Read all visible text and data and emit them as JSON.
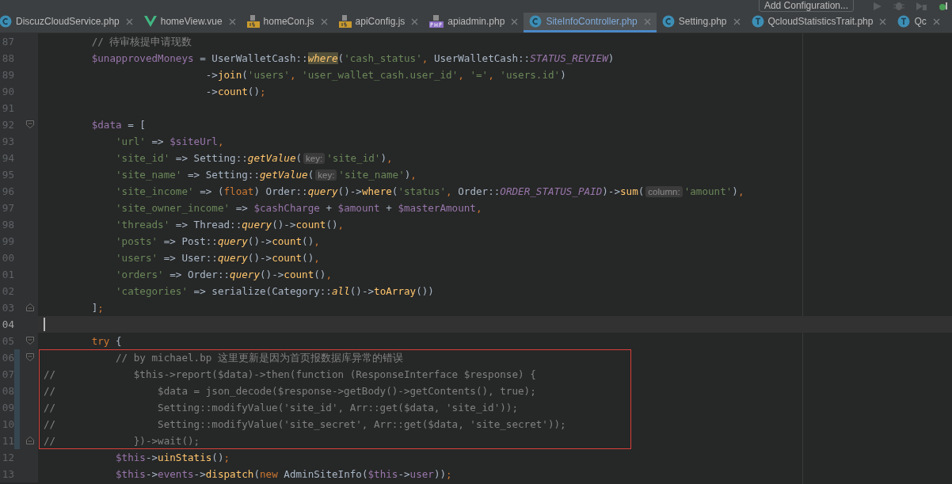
{
  "toolbar": {
    "run_configuration": "Add Configuration..."
  },
  "tabs": [
    {
      "label": "DiscuzCloudService.php",
      "kind": "class",
      "selected": false
    },
    {
      "label": "homeView.vue",
      "kind": "vue",
      "selected": false
    },
    {
      "label": "homeCon.js",
      "kind": "js",
      "selected": false
    },
    {
      "label": "apiConfig.js",
      "kind": "js",
      "selected": false
    },
    {
      "label": "apiadmin.php",
      "kind": "php",
      "selected": false
    },
    {
      "label": "SiteInfoController.php",
      "kind": "class",
      "selected": true
    },
    {
      "label": "Setting.php",
      "kind": "class",
      "selected": false
    },
    {
      "label": "QcloudStatisticsTrait.php",
      "kind": "trait",
      "selected": false
    },
    {
      "label": "Qc",
      "kind": "trait",
      "selected": false
    }
  ],
  "editor": {
    "lines": [
      {
        "number": "87",
        "current": false,
        "changed": false,
        "framed": false,
        "tokens": [
          {
            "kind": "comment",
            "text": "        // 待审核提申请现数"
          }
        ]
      },
      {
        "number": "88",
        "current": false,
        "changed": false,
        "framed": false,
        "tokens": [
          {
            "kind": "var",
            "text": "        $unapprovedMoneys"
          },
          {
            "kind": "plain",
            "text": " = UserWalletCash::"
          },
          {
            "kind": "match",
            "text": "where"
          },
          {
            "kind": "plain",
            "text": "("
          },
          {
            "kind": "str",
            "text": "'cash_status'"
          },
          {
            "kind": "punct",
            "text": ", "
          },
          {
            "kind": "plain",
            "text": "UserWalletCash::"
          },
          {
            "kind": "const",
            "text": "STATUS_REVIEW"
          },
          {
            "kind": "plain",
            "text": ")"
          }
        ]
      },
      {
        "number": "89",
        "current": false,
        "changed": false,
        "framed": false,
        "tokens": [
          {
            "kind": "plain",
            "text": "                           ->"
          },
          {
            "kind": "fn",
            "text": "join"
          },
          {
            "kind": "plain",
            "text": "("
          },
          {
            "kind": "str",
            "text": "'users'"
          },
          {
            "kind": "punct",
            "text": ", "
          },
          {
            "kind": "str",
            "text": "'user_wallet_cash.user_id'"
          },
          {
            "kind": "punct",
            "text": ", "
          },
          {
            "kind": "str",
            "text": "'='"
          },
          {
            "kind": "punct",
            "text": ", "
          },
          {
            "kind": "str",
            "text": "'users.id'"
          },
          {
            "kind": "plain",
            "text": ")"
          }
        ]
      },
      {
        "number": "90",
        "current": false,
        "changed": false,
        "framed": false,
        "tokens": [
          {
            "kind": "plain",
            "text": "                           ->"
          },
          {
            "kind": "fn",
            "text": "count"
          },
          {
            "kind": "plain",
            "text": "()"
          },
          {
            "kind": "punct",
            "text": ";"
          }
        ]
      },
      {
        "number": "91",
        "current": false,
        "changed": false,
        "framed": false
      },
      {
        "number": "92",
        "current": false,
        "changed": false,
        "framed": false,
        "kind": "opener",
        "tokens": [
          {
            "kind": "var",
            "text": "        $data"
          },
          {
            "kind": "plain",
            "text": " = ["
          }
        ]
      },
      {
        "number": "93",
        "current": false,
        "changed": false,
        "framed": false,
        "tokens": [
          {
            "kind": "str",
            "text": "            'url'"
          },
          {
            "kind": "plain",
            "text": " => "
          },
          {
            "kind": "var",
            "text": "$siteUrl"
          },
          {
            "kind": "punct",
            "text": ","
          }
        ]
      },
      {
        "number": "94",
        "current": false,
        "changed": false,
        "framed": false,
        "tokens": [
          {
            "kind": "str",
            "text": "            'site_id'"
          },
          {
            "kind": "plain",
            "text": " => Setting::"
          },
          {
            "kind": "static",
            "text": "getValue"
          },
          {
            "kind": "plain",
            "text": "("
          },
          {
            "kind": "hint",
            "text": "key:"
          },
          {
            "kind": "str",
            "text": "'site_id'"
          },
          {
            "kind": "plain",
            "text": ")"
          },
          {
            "kind": "punct",
            "text": ","
          }
        ]
      },
      {
        "number": "95",
        "current": false,
        "changed": false,
        "framed": false,
        "tokens": [
          {
            "kind": "str",
            "text": "            'site_name'"
          },
          {
            "kind": "plain",
            "text": " => Setting::"
          },
          {
            "kind": "static",
            "text": "getValue"
          },
          {
            "kind": "plain",
            "text": "("
          },
          {
            "kind": "hint",
            "text": "key:"
          },
          {
            "kind": "str",
            "text": "'site_name'"
          },
          {
            "kind": "plain",
            "text": ")"
          },
          {
            "kind": "punct",
            "text": ","
          }
        ]
      },
      {
        "number": "96",
        "current": false,
        "changed": false,
        "framed": false,
        "tokens": [
          {
            "kind": "str",
            "text": "            'site_income'"
          },
          {
            "kind": "plain",
            "text": " => ("
          },
          {
            "kind": "kw",
            "text": "float"
          },
          {
            "kind": "plain",
            "text": ") Order::"
          },
          {
            "kind": "static",
            "text": "query"
          },
          {
            "kind": "plain",
            "text": "()->"
          },
          {
            "kind": "fn",
            "text": "where"
          },
          {
            "kind": "plain",
            "text": "("
          },
          {
            "kind": "str",
            "text": "'status'"
          },
          {
            "kind": "punct",
            "text": ", "
          },
          {
            "kind": "plain",
            "text": "Order::"
          },
          {
            "kind": "const",
            "text": "ORDER_STATUS_PAID"
          },
          {
            "kind": "plain",
            "text": ")->"
          },
          {
            "kind": "fn",
            "text": "sum"
          },
          {
            "kind": "plain",
            "text": "("
          },
          {
            "kind": "hint",
            "text": "column:"
          },
          {
            "kind": "str",
            "text": "'amount'"
          },
          {
            "kind": "plain",
            "text": ")"
          },
          {
            "kind": "punct",
            "text": ","
          }
        ]
      },
      {
        "number": "97",
        "current": false,
        "changed": false,
        "framed": false,
        "tokens": [
          {
            "kind": "str",
            "text": "            'site_owner_income'"
          },
          {
            "kind": "plain",
            "text": " => "
          },
          {
            "kind": "var",
            "text": "$cashCharge"
          },
          {
            "kind": "plain",
            "text": " + "
          },
          {
            "kind": "var",
            "text": "$amount"
          },
          {
            "kind": "plain",
            "text": " + "
          },
          {
            "kind": "var",
            "text": "$masterAmount"
          },
          {
            "kind": "punct",
            "text": ","
          }
        ]
      },
      {
        "number": "98",
        "current": false,
        "changed": false,
        "framed": false,
        "tokens": [
          {
            "kind": "str",
            "text": "            'threads'"
          },
          {
            "kind": "plain",
            "text": " => Thread::"
          },
          {
            "kind": "static",
            "text": "query"
          },
          {
            "kind": "plain",
            "text": "()->"
          },
          {
            "kind": "fn",
            "text": "count"
          },
          {
            "kind": "plain",
            "text": "()"
          },
          {
            "kind": "punct",
            "text": ","
          }
        ]
      },
      {
        "number": "99",
        "current": false,
        "changed": false,
        "framed": false,
        "tokens": [
          {
            "kind": "str",
            "text": "            'posts'"
          },
          {
            "kind": "plain",
            "text": " => Post::"
          },
          {
            "kind": "static",
            "text": "query"
          },
          {
            "kind": "plain",
            "text": "()->"
          },
          {
            "kind": "fn",
            "text": "count"
          },
          {
            "kind": "plain",
            "text": "()"
          },
          {
            "kind": "punct",
            "text": ","
          }
        ]
      },
      {
        "number": "00",
        "current": false,
        "changed": false,
        "framed": false,
        "tokens": [
          {
            "kind": "str",
            "text": "            'users'"
          },
          {
            "kind": "plain",
            "text": " => User::"
          },
          {
            "kind": "static",
            "text": "query"
          },
          {
            "kind": "plain",
            "text": "()->"
          },
          {
            "kind": "fn",
            "text": "count"
          },
          {
            "kind": "plain",
            "text": "()"
          },
          {
            "kind": "punct",
            "text": ","
          }
        ]
      },
      {
        "number": "01",
        "current": false,
        "changed": false,
        "framed": false,
        "tokens": [
          {
            "kind": "str",
            "text": "            'orders'"
          },
          {
            "kind": "plain",
            "text": " => Order::"
          },
          {
            "kind": "static",
            "text": "query"
          },
          {
            "kind": "plain",
            "text": "()->"
          },
          {
            "kind": "fn",
            "text": "count"
          },
          {
            "kind": "plain",
            "text": "()"
          },
          {
            "kind": "punct",
            "text": ","
          }
        ]
      },
      {
        "number": "02",
        "current": false,
        "changed": false,
        "framed": false,
        "tokens": [
          {
            "kind": "str",
            "text": "            'categories'"
          },
          {
            "kind": "plain",
            "text": " => serialize(Category::"
          },
          {
            "kind": "static",
            "text": "all"
          },
          {
            "kind": "plain",
            "text": "()->"
          },
          {
            "kind": "fn",
            "text": "toArray"
          },
          {
            "kind": "plain",
            "text": "())"
          }
        ]
      },
      {
        "number": "03",
        "current": false,
        "changed": false,
        "framed": false,
        "kind": "closer",
        "tokens": [
          {
            "kind": "plain",
            "text": "        ]"
          },
          {
            "kind": "punct",
            "text": ";"
          }
        ]
      },
      {
        "number": "04",
        "current": true,
        "changed": false,
        "framed": false
      },
      {
        "number": "05",
        "current": false,
        "changed": false,
        "framed": false,
        "kind": "opener",
        "tokens": [
          {
            "kind": "kw",
            "text": "        try"
          },
          {
            "kind": "plain",
            "text": " {"
          }
        ]
      },
      {
        "number": "06",
        "current": false,
        "changed": true,
        "framed": true,
        "kind": "opener",
        "tokens": [
          {
            "kind": "comment",
            "text": "            // by michael.bp 这里更新是因为首页报数据库异常的错误"
          }
        ]
      },
      {
        "number": "07",
        "current": false,
        "changed": true,
        "framed": true,
        "tokens": [
          {
            "kind": "comment",
            "text": "//             $this->report($data)->then(function (ResponseInterface $response) {"
          }
        ]
      },
      {
        "number": "08",
        "current": false,
        "changed": true,
        "framed": true,
        "tokens": [
          {
            "kind": "comment",
            "text": "//                 $data = json_decode($response->getBody()->getContents(), true);"
          }
        ]
      },
      {
        "number": "09",
        "current": false,
        "changed": true,
        "framed": true,
        "tokens": [
          {
            "kind": "comment",
            "text": "//                 Setting::modifyValue('site_id', Arr::get($data, 'site_id'));"
          }
        ]
      },
      {
        "number": "10",
        "current": false,
        "changed": true,
        "framed": true,
        "tokens": [
          {
            "kind": "comment",
            "text": "//                 Setting::modifyValue('site_secret', Arr::get($data, 'site_secret'));"
          }
        ]
      },
      {
        "number": "11",
        "current": false,
        "changed": true,
        "framed": true,
        "kind": "closer",
        "tokens": [
          {
            "kind": "comment",
            "text": "//             })->wait();"
          }
        ]
      },
      {
        "number": "12",
        "current": false,
        "changed": false,
        "framed": false,
        "tokens": [
          {
            "kind": "var",
            "text": "            $this"
          },
          {
            "kind": "plain",
            "text": "->"
          },
          {
            "kind": "fn",
            "text": "uinStatis"
          },
          {
            "kind": "plain",
            "text": "()"
          },
          {
            "kind": "punct",
            "text": ";"
          }
        ]
      },
      {
        "number": "13",
        "current": false,
        "changed": false,
        "framed": false,
        "tokens": [
          {
            "kind": "var",
            "text": "            $this"
          },
          {
            "kind": "plain",
            "text": "->"
          },
          {
            "kind": "var",
            "text": "events"
          },
          {
            "kind": "plain",
            "text": "->"
          },
          {
            "kind": "fn",
            "text": "dispatch"
          },
          {
            "kind": "plain",
            "text": "("
          },
          {
            "kind": "kw",
            "text": "new"
          },
          {
            "kind": "plain",
            "text": " AdminSiteInfo("
          },
          {
            "kind": "var",
            "text": "$this"
          },
          {
            "kind": "plain",
            "text": "->"
          },
          {
            "kind": "var",
            "text": "user"
          },
          {
            "kind": "plain",
            "text": "))"
          },
          {
            "kind": "punct",
            "text": ";"
          }
        ]
      }
    ]
  }
}
